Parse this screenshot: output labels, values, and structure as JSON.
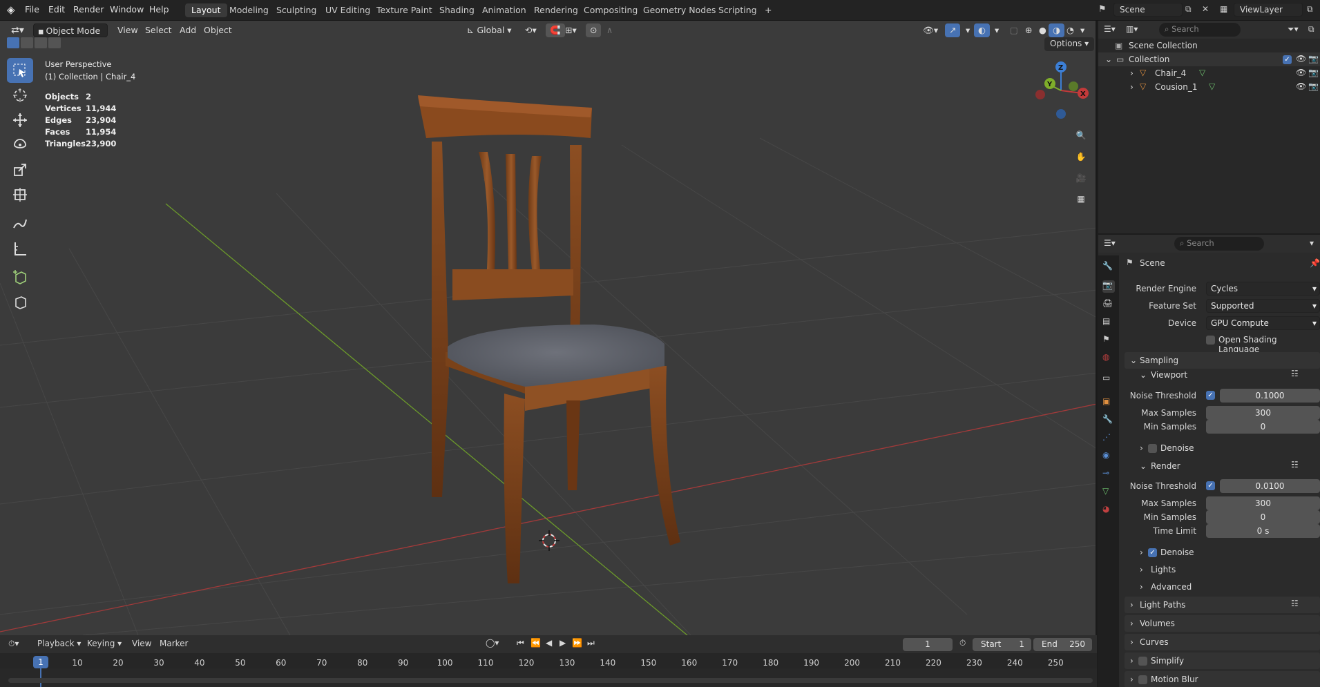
{
  "topbar": {
    "menus": [
      "File",
      "Edit",
      "Render",
      "Window",
      "Help"
    ],
    "workspaces": [
      "Layout",
      "Modeling",
      "Sculpting",
      "UV Editing",
      "Texture Paint",
      "Shading",
      "Animation",
      "Rendering",
      "Compositing",
      "Geometry Nodes",
      "Scripting"
    ],
    "active_workspace": "Layout",
    "add_tab": "+",
    "scene": "Scene",
    "view_layer": "ViewLayer"
  },
  "viewport": {
    "mode": "Object Mode",
    "menus": [
      "View",
      "Select",
      "Add",
      "Object"
    ],
    "transform_orientation": "Global",
    "options": "Options",
    "overlay_title": "User Perspective",
    "overlay_subtitle": "(1) Collection | Chair_4",
    "stats": [
      {
        "label": "Objects",
        "value": "2"
      },
      {
        "label": "Vertices",
        "value": "11,944"
      },
      {
        "label": "Edges",
        "value": "23,904"
      },
      {
        "label": "Faces",
        "value": "11,954"
      },
      {
        "label": "Triangles",
        "value": "23,900"
      }
    ],
    "gizmo": {
      "x": "X",
      "y": "Y",
      "z": "Z"
    },
    "colors": {
      "x_axis": "#c23a3a",
      "y_axis": "#7fae2a",
      "z_axis": "#3c7fd6",
      "active_tool": "#4772b3"
    }
  },
  "outliner": {
    "search_placeholder": "Search",
    "root": "Scene Collection",
    "collection": "Collection",
    "items": [
      "Chair_4",
      "Cousion_1"
    ]
  },
  "properties": {
    "search_placeholder": "Search",
    "context": "Scene",
    "render_engine_label": "Render Engine",
    "render_engine": "Cycles",
    "feature_set_label": "Feature Set",
    "feature_set": "Supported",
    "device_label": "Device",
    "device": "GPU Compute",
    "osl": "Open Shading Language",
    "sampling": "Sampling",
    "viewport": "Viewport",
    "noise_threshold": "Noise Threshold",
    "vp_noise": "0.1000",
    "max_samples": "Max Samples",
    "vp_max": "300",
    "min_samples": "Min Samples",
    "vp_min": "0",
    "denoise": "Denoise",
    "render": "Render",
    "r_noise": "0.0100",
    "r_max": "300",
    "r_min": "0",
    "time_limit": "Time Limit",
    "r_time": "0 s",
    "lights": "Lights",
    "advanced": "Advanced",
    "light_paths": "Light Paths",
    "volumes": "Volumes",
    "curves": "Curves",
    "simplify": "Simplify",
    "motion_blur": "Motion Blur"
  },
  "timeline": {
    "menus": [
      "Playback",
      "Keying",
      "View",
      "Marker"
    ],
    "current_frame": "1",
    "start_label": "Start",
    "start": "1",
    "end_label": "End",
    "end": "250",
    "ticks": [
      "1",
      "10",
      "20",
      "30",
      "40",
      "50",
      "60",
      "70",
      "80",
      "90",
      "100",
      "110",
      "120",
      "130",
      "140",
      "150",
      "160",
      "170",
      "180",
      "190",
      "200",
      "210",
      "220",
      "230",
      "240",
      "250"
    ]
  }
}
